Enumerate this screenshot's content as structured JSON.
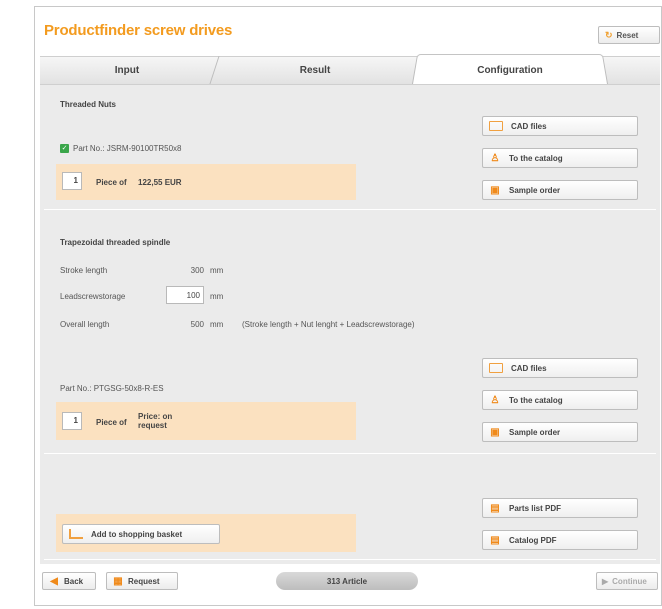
{
  "header": {
    "title": "Productfinder screw drives",
    "reset_label": "Reset"
  },
  "tabs": [
    {
      "label": "Input"
    },
    {
      "label": "Result"
    },
    {
      "label": "Configuration"
    }
  ],
  "nut": {
    "title": "Threaded Nuts",
    "part_no": "Part No.: JSRM-90100TR50x8",
    "qty": "1",
    "price_text": "Piece of",
    "price_value": "122,55 EUR",
    "buttons": {
      "cad": "CAD files",
      "catalog": "To the catalog",
      "sample": "Sample order"
    }
  },
  "spindle": {
    "title": "Trapezoidal threaded spindle",
    "stroke_label": "Stroke length",
    "stroke_value": "300",
    "stroke_unit": "mm",
    "lead_label": "Leadscrewstorage",
    "lead_value": "100",
    "lead_unit": "mm",
    "overall_label": "Overall length",
    "overall_value": "500",
    "overall_unit": "mm",
    "overall_formula": "(Stroke length + Nut lenght + Leadscrewstorage)",
    "part_no": "Part No.: PTGSG-50x8-R-ES",
    "qty": "1",
    "price_text": "Piece of",
    "price_request": "Price: on request",
    "buttons": {
      "cad": "CAD files",
      "catalog": "To the catalog",
      "sample": "Sample order"
    }
  },
  "basket": {
    "add_label": "Add to shopping basket",
    "parts_list_pdf": "Parts list PDF",
    "catalog_pdf": "Catalog PDF"
  },
  "footer": {
    "back": "Back",
    "request": "Request",
    "articles": "313 Article",
    "continue": "Continue"
  },
  "colors": {
    "title_orange": "#f39b1f",
    "panel_orange": "#fbe1c0",
    "panel_gray": "#ebebeb"
  }
}
